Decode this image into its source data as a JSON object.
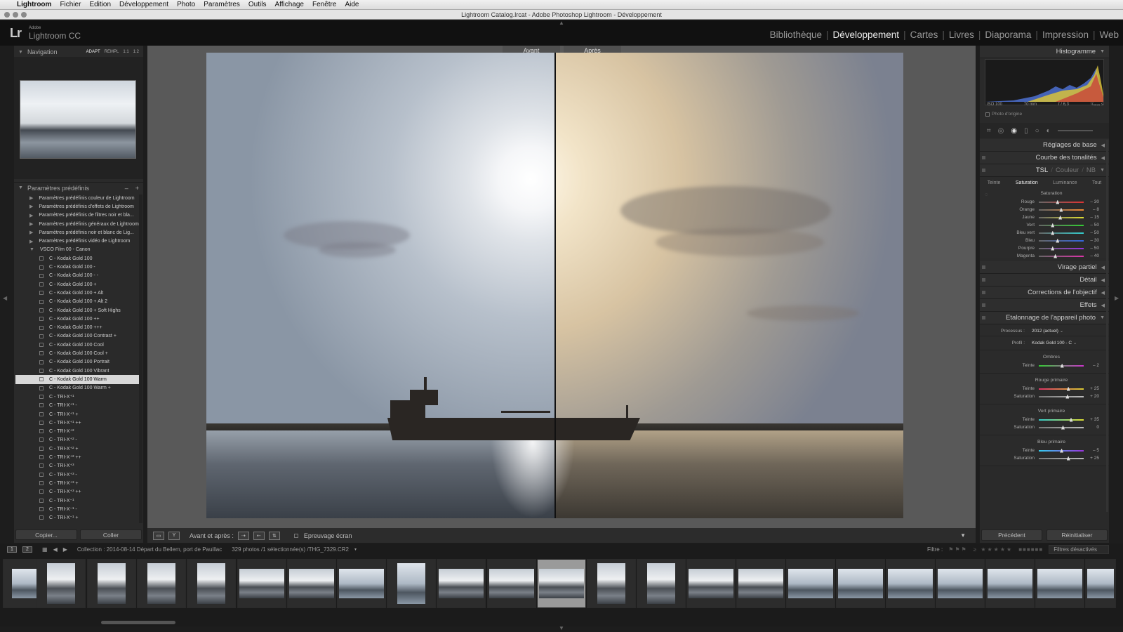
{
  "menubar": {
    "items": [
      "Lightroom",
      "Fichier",
      "Edition",
      "Développement",
      "Photo",
      "Paramètres",
      "Outils",
      "Affichage",
      "Fenêtre",
      "Aide"
    ]
  },
  "window": {
    "title": "Lightroom Catalog.lrcat - Adobe Photoshop Lightroom - Développement"
  },
  "identity": {
    "lr": "Lr",
    "adobe": "Adobe",
    "product": "Lightroom CC"
  },
  "modules": [
    "Bibliothèque",
    "Développement",
    "Cartes",
    "Livres",
    "Diaporama",
    "Impression",
    "Web"
  ],
  "active_module": "Développement",
  "navigator": {
    "title": "Navigation",
    "zoom_options": [
      "ADAPT",
      "REMPL",
      "1:1",
      "1:2"
    ]
  },
  "presets": {
    "title": "Paramètres prédéfinis",
    "minus": "–",
    "plus": "+",
    "folders": [
      "Paramètres prédéfinis couleur de Lightroom",
      "Paramètres prédéfinis d'effets de Lightroom",
      "Paramètres prédéfinis de filtres noir et bla...",
      "Paramètres prédéfinis généraux de Lightroom",
      "Paramètres prédéfinis noir et blanc de Lig...",
      "Paramètres prédéfinis vidéo de Lightroom"
    ],
    "open_folder": "VSCO Film 00 - Canon",
    "items": [
      "C - Kodak Gold 100",
      "C - Kodak Gold 100 -",
      "C - Kodak Gold 100 - -",
      "C - Kodak Gold 100 +",
      "C - Kodak Gold 100 + Alt",
      "C - Kodak Gold 100 + Alt 2",
      "C - Kodak Gold 100 + Soft Highs",
      "C - Kodak Gold 100 ++",
      "C - Kodak Gold 100 +++",
      "C - Kodak Gold 100 Contrast +",
      "C - Kodak Gold 100 Cool",
      "C - Kodak Gold 100 Cool +",
      "C - Kodak Gold 100 Portrait",
      "C - Kodak Gold 100 Vibrant",
      "C - Kodak Gold 100 Warm",
      "C - Kodak Gold 100 Warm +",
      "C - TRI-X⁺¹",
      "C - TRI-X⁺¹ -",
      "C - TRI-X⁺¹ +",
      "C - TRI-X⁺¹ ++",
      "C - TRI-X⁺²",
      "C - TRI-X⁺² -",
      "C - TRI-X⁺² +",
      "C - TRI-X⁺² ++",
      "C - TRI-X⁺³",
      "C - TRI-X⁺³ -",
      "C - TRI-X⁺³ +",
      "C - TRI-X⁺³ ++",
      "C - TRI-X⁻¹",
      "C - TRI-X⁻¹ -",
      "C - TRI-X⁻¹ +"
    ],
    "selected_index": 14
  },
  "left_buttons": {
    "copy": "Copier...",
    "paste": "Coller"
  },
  "compare": {
    "before": "Avant",
    "after": "Après"
  },
  "toolbar": {
    "before_after": "Avant et après :",
    "softproof": "Epreuvage écran"
  },
  "filmstrip_bar": {
    "collection": "Collection : 2014-08-14 Départ du Bellem, port de Pauillac",
    "count": "329 photos /1 sélectionnée(s) /THG_7329.CR2",
    "filter_label": "Filtre :",
    "filter_value": "Filtres désactivés"
  },
  "histogram": {
    "title": "Histogramme",
    "iso": "ISO 100",
    "focal": "70 mm",
    "aperture": "f / 6,3",
    "shutter": "¹/₄₀₀₀ s",
    "original": "Photo d'origine"
  },
  "right_panels": {
    "basic": "Réglages de base",
    "curve": "Courbe des tonalités",
    "hsl": {
      "tsl": "TSL",
      "couleur": "Couleur",
      "nb": "NB",
      "tabs": [
        "Teinte",
        "Saturation",
        "Luminance",
        "Tout"
      ],
      "active_tab": "Saturation",
      "group": "Saturation",
      "rows": [
        {
          "label": "Rouge",
          "value": "– 30",
          "pos": 0.38
        },
        {
          "label": "Orange",
          "value": "– 8",
          "pos": 0.46
        },
        {
          "label": "Jaune",
          "value": "– 15",
          "pos": 0.44
        },
        {
          "label": "Vert",
          "value": "– 50",
          "pos": 0.27
        },
        {
          "label": "Bleu vert",
          "value": "– 50",
          "pos": 0.27
        },
        {
          "label": "Bleu",
          "value": "– 30",
          "pos": 0.38
        },
        {
          "label": "Pourpre",
          "value": "– 50",
          "pos": 0.27
        },
        {
          "label": "Magenta",
          "value": "– 40",
          "pos": 0.33
        }
      ]
    },
    "split": "Virage partiel",
    "detail": "Détail",
    "lens": "Corrections de l'objectif",
    "effects": "Effets",
    "calibration": {
      "title": "Etalonnage de l'appareil photo",
      "process_label": "Processus :",
      "process_value": "2012 (actuel)",
      "profile_label": "Profil :",
      "profile_value": "Kodak Gold 100 - C",
      "groups": [
        {
          "name": "Ombres",
          "rows": [
            {
              "label": "Teinte",
              "value": "– 2",
              "pos": 0.48
            }
          ]
        },
        {
          "name": "Rouge primaire",
          "rows": [
            {
              "label": "Teinte",
              "value": "+ 25",
              "pos": 0.62
            },
            {
              "label": "Saturation",
              "value": "+ 20",
              "pos": 0.6
            }
          ]
        },
        {
          "name": "Vert primaire",
          "rows": [
            {
              "label": "Teinte",
              "value": "+ 35",
              "pos": 0.68
            },
            {
              "label": "Saturation",
              "value": "0",
              "pos": 0.5
            }
          ]
        },
        {
          "name": "Bleu primaire",
          "rows": [
            {
              "label": "Teinte",
              "value": "– 5",
              "pos": 0.47
            },
            {
              "label": "Saturation",
              "value": "+ 25",
              "pos": 0.62
            }
          ]
        }
      ]
    }
  },
  "right_buttons": {
    "previous": "Précédent",
    "reset": "Réinitialiser"
  }
}
